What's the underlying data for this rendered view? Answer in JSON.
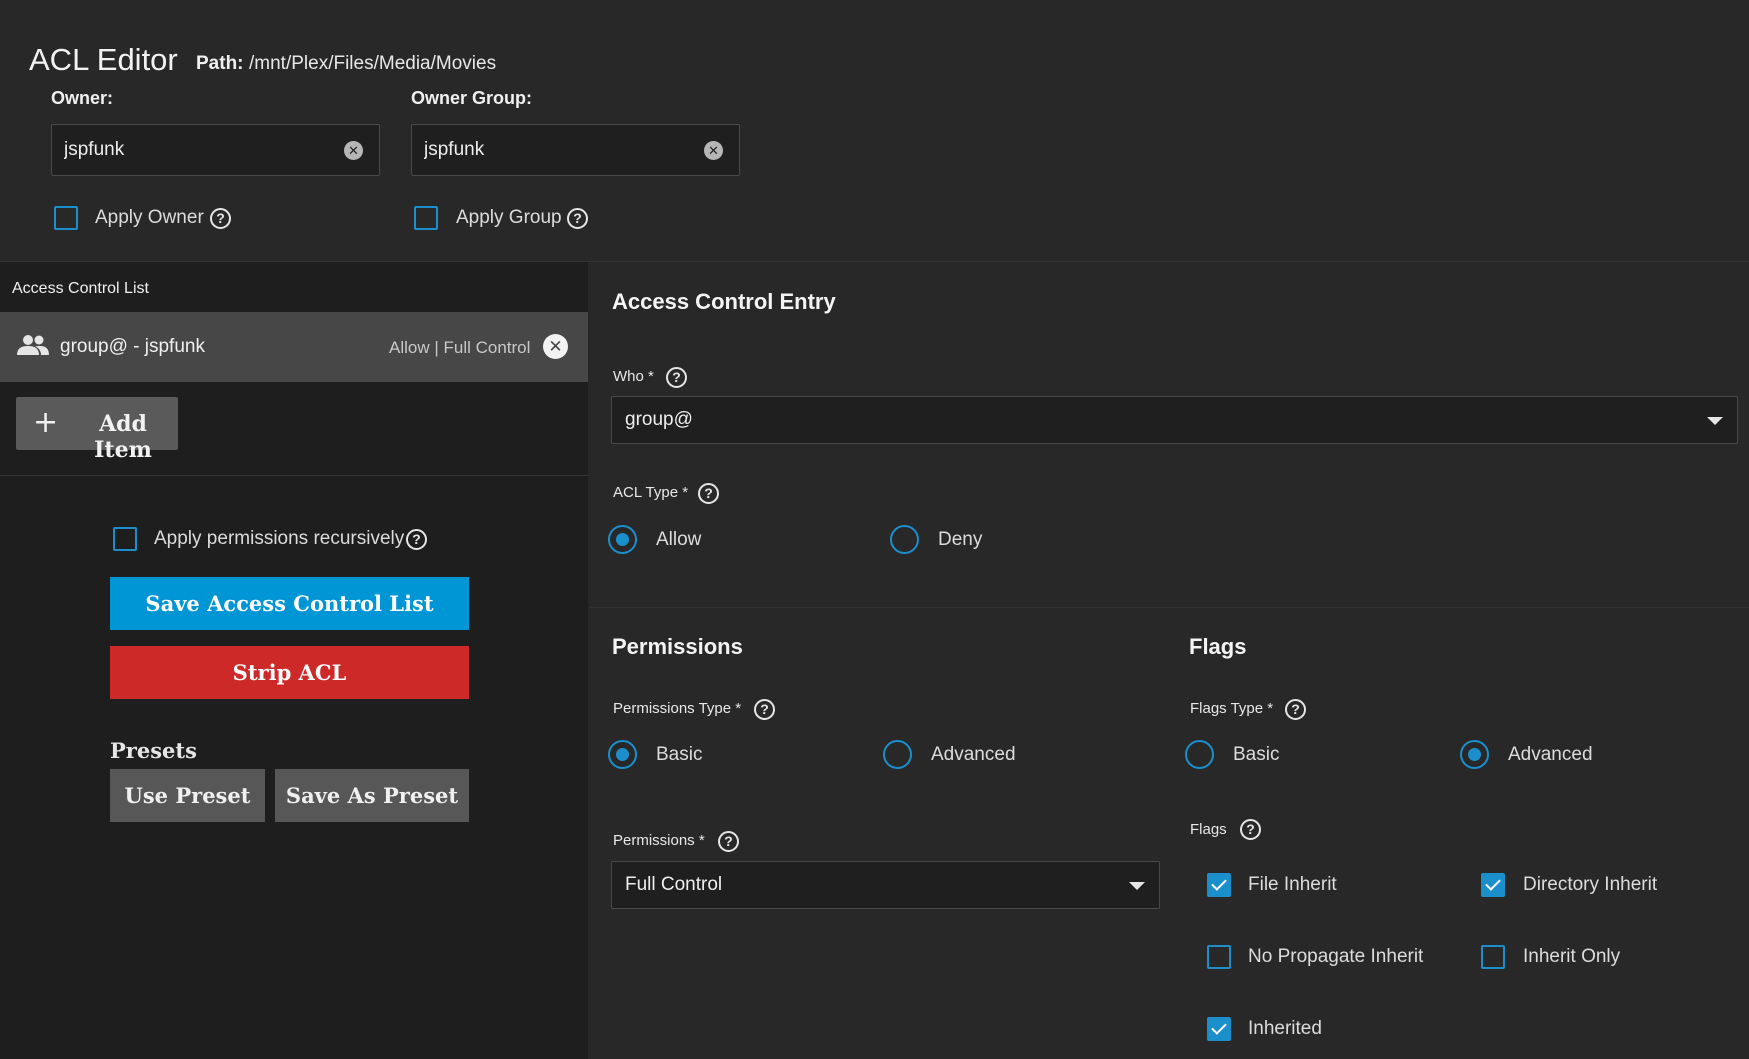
{
  "header": {
    "title": "ACL Editor",
    "path_label": "Path:",
    "path_value": "/mnt/Plex/Files/Media/Movies"
  },
  "owner": {
    "label": "Owner:",
    "value": "jspfunk",
    "apply_label": "Apply Owner"
  },
  "owner_group": {
    "label": "Owner Group:",
    "value": "jspfunk",
    "apply_label": "Apply Group"
  },
  "acl_list": {
    "title": "Access Control List",
    "items": [
      {
        "label": "group@ - jspfunk",
        "summary": "Allow | Full Control"
      }
    ],
    "add_item_label": "Add Item"
  },
  "actions": {
    "recursive_label": "Apply permissions recursively",
    "save_label": "Save Access Control List",
    "strip_label": "Strip ACL",
    "presets_title": "Presets",
    "use_preset_label": "Use Preset",
    "save_as_preset_label": "Save As Preset"
  },
  "entry": {
    "title": "Access Control Entry",
    "who_label": "Who *",
    "who_value": "group@",
    "acl_type_label": "ACL Type *",
    "acl_type_options": [
      "Allow",
      "Deny"
    ],
    "acl_type_selected": "Allow"
  },
  "permissions": {
    "title": "Permissions",
    "type_label": "Permissions Type *",
    "type_options": [
      "Basic",
      "Advanced"
    ],
    "type_selected": "Basic",
    "perm_label": "Permissions *",
    "perm_value": "Full Control"
  },
  "flags": {
    "title": "Flags",
    "type_label": "Flags Type *",
    "type_options": [
      "Basic",
      "Advanced"
    ],
    "type_selected": "Advanced",
    "flags_label": "Flags",
    "items": [
      {
        "label": "File Inherit",
        "checked": true
      },
      {
        "label": "Directory Inherit",
        "checked": true
      },
      {
        "label": "No Propagate Inherit",
        "checked": false
      },
      {
        "label": "Inherit Only",
        "checked": false
      },
      {
        "label": "Inherited",
        "checked": true
      }
    ]
  },
  "icons": {
    "help": "help-circle-icon",
    "clear": "clear-icon",
    "group": "group-icon",
    "remove": "close-circle-icon",
    "add": "plus-icon",
    "dropdown": "chevron-down-icon"
  },
  "colors": {
    "accent": "#1a8fcc",
    "primary_button": "#0095d5",
    "danger_button": "#ce2929",
    "background": "#282828",
    "panel": "#1e1e1e"
  }
}
